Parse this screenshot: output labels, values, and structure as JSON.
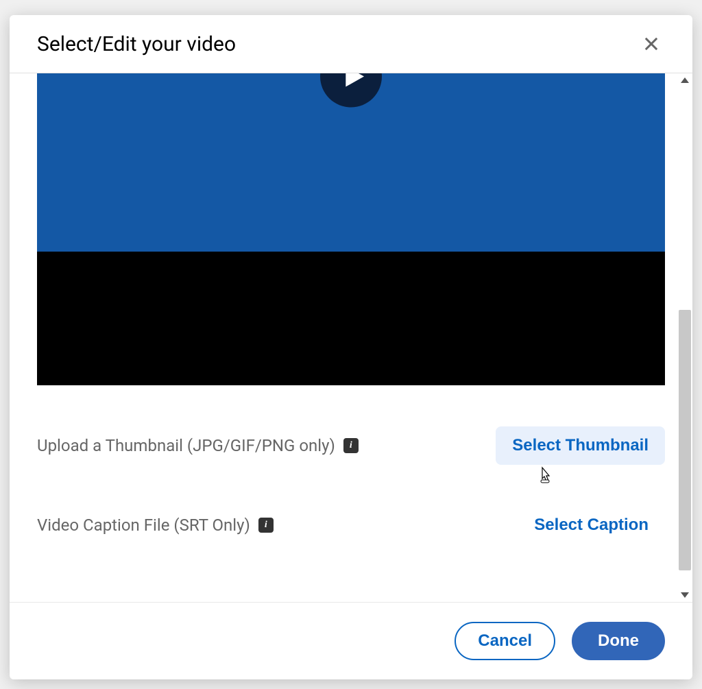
{
  "modal": {
    "title": "Select/Edit your video",
    "close_aria": "Close"
  },
  "thumbnail": {
    "label": "Upload a Thumbnail (JPG/GIF/PNG only)",
    "info_tooltip": "i",
    "button_label": "Select Thumbnail"
  },
  "caption": {
    "label": "Video Caption File (SRT Only)",
    "info_tooltip": "i",
    "button_label": "Select Caption"
  },
  "footer": {
    "cancel_label": "Cancel",
    "done_label": "Done"
  },
  "colors": {
    "primary_blue": "#0a66c2",
    "button_blue": "#3166b8",
    "video_blue": "#1458a5"
  }
}
